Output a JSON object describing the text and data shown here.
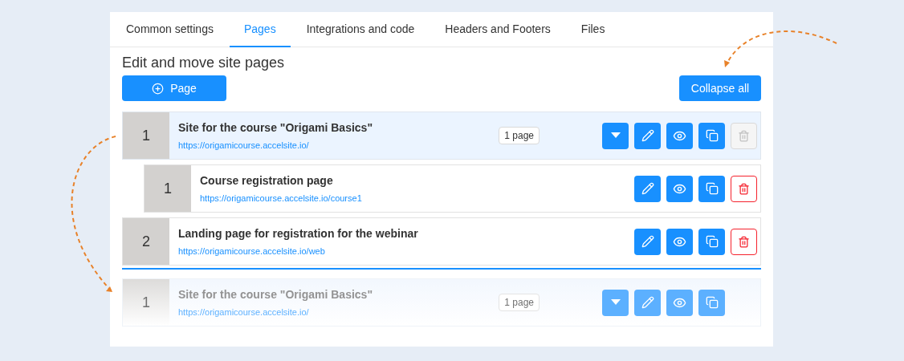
{
  "tabs": [
    {
      "label": "Common settings",
      "selected": false
    },
    {
      "label": "Pages",
      "selected": true
    },
    {
      "label": "Integrations and code",
      "selected": false
    },
    {
      "label": "Headers and Footers",
      "selected": false
    },
    {
      "label": "Files",
      "selected": false
    }
  ],
  "heading": "Edit and move site pages",
  "add_button": "Page",
  "collapse_button": "Collapse all",
  "pages": [
    {
      "number": "1",
      "title": "Site for the course \"Origami Basics\"",
      "url": "https://origamicourse.accelsite.io/",
      "badge": "1 page",
      "selected": true,
      "delete_disabled": true,
      "children": [
        {
          "number": "1",
          "title": "Course registration page",
          "url": "https://origamicourse.accelsite.io/course1",
          "selected": false,
          "delete_disabled": false
        }
      ]
    },
    {
      "number": "2",
      "title": "Landing page for registration for the webinar",
      "url": "https://origamicourse.accelsite.io/web",
      "selected": false,
      "delete_disabled": false
    }
  ],
  "drag_ghost": {
    "number": "1",
    "title": "Site for the course \"Origami Basics\"",
    "url": "https://origamicourse.accelsite.io/",
    "badge": "1 page"
  }
}
